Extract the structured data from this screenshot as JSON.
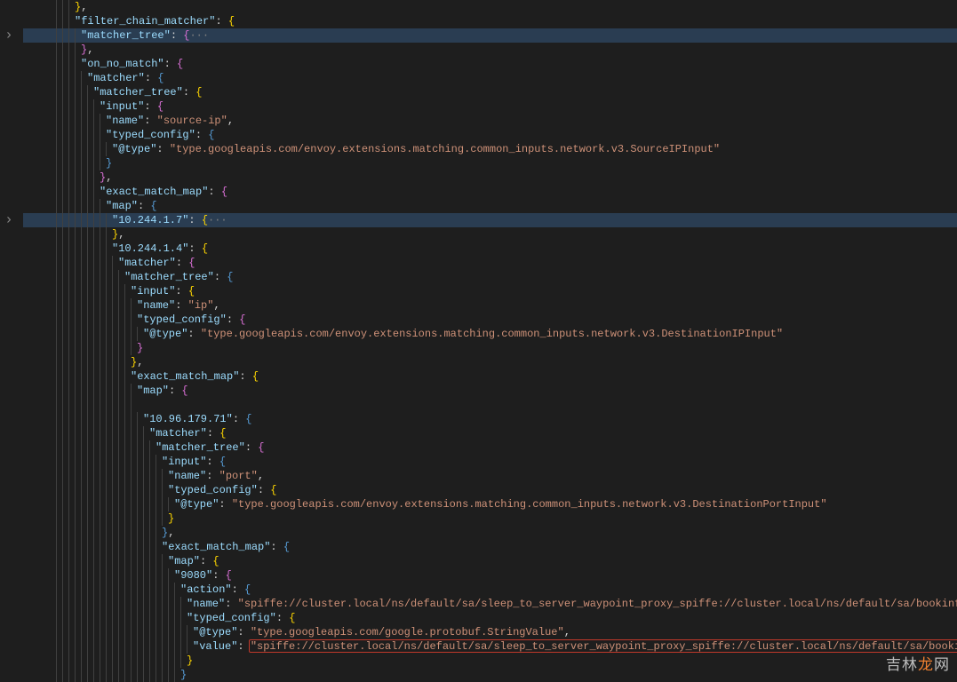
{
  "lines": [
    {
      "indent": 4,
      "parts": [
        {
          "c": "brace",
          "t": "}"
        },
        {
          "c": "punct",
          "t": ","
        }
      ],
      "hl": false
    },
    {
      "indent": 4,
      "parts": [
        {
          "c": "key",
          "t": "\"filter_chain_matcher\""
        },
        {
          "c": "punct",
          "t": ": "
        },
        {
          "c": "brace",
          "t": "{"
        }
      ],
      "hl": false
    },
    {
      "indent": 5,
      "parts": [
        {
          "c": "key",
          "t": "\"matcher_tree\""
        },
        {
          "c": "punct",
          "t": ": "
        },
        {
          "c": "brace-p",
          "t": "{"
        },
        {
          "c": "fold-dots",
          "t": "···"
        }
      ],
      "hl": true,
      "fold": true
    },
    {
      "indent": 5,
      "parts": [
        {
          "c": "brace-p",
          "t": "}"
        },
        {
          "c": "punct",
          "t": ","
        }
      ],
      "hl": false
    },
    {
      "indent": 5,
      "parts": [
        {
          "c": "key",
          "t": "\"on_no_match\""
        },
        {
          "c": "punct",
          "t": ": "
        },
        {
          "c": "brace-p",
          "t": "{"
        }
      ],
      "hl": false
    },
    {
      "indent": 6,
      "parts": [
        {
          "c": "key",
          "t": "\"matcher\""
        },
        {
          "c": "punct",
          "t": ": "
        },
        {
          "c": "brace-b",
          "t": "{"
        }
      ],
      "hl": false
    },
    {
      "indent": 7,
      "parts": [
        {
          "c": "key",
          "t": "\"matcher_tree\""
        },
        {
          "c": "punct",
          "t": ": "
        },
        {
          "c": "brace",
          "t": "{"
        }
      ],
      "hl": false
    },
    {
      "indent": 8,
      "parts": [
        {
          "c": "key",
          "t": "\"input\""
        },
        {
          "c": "punct",
          "t": ": "
        },
        {
          "c": "brace-p",
          "t": "{"
        }
      ],
      "hl": false
    },
    {
      "indent": 9,
      "parts": [
        {
          "c": "key",
          "t": "\"name\""
        },
        {
          "c": "punct",
          "t": ": "
        },
        {
          "c": "str",
          "t": "\"source-ip\""
        },
        {
          "c": "punct",
          "t": ","
        }
      ],
      "hl": false
    },
    {
      "indent": 9,
      "parts": [
        {
          "c": "key",
          "t": "\"typed_config\""
        },
        {
          "c": "punct",
          "t": ": "
        },
        {
          "c": "brace-b",
          "t": "{"
        }
      ],
      "hl": false
    },
    {
      "indent": 10,
      "parts": [
        {
          "c": "key",
          "t": "\"@type\""
        },
        {
          "c": "punct",
          "t": ": "
        },
        {
          "c": "str",
          "t": "\"type.googleapis.com/envoy.extensions.matching.common_inputs.network.v3.SourceIPInput\""
        }
      ],
      "hl": false
    },
    {
      "indent": 9,
      "parts": [
        {
          "c": "brace-b",
          "t": "}"
        }
      ],
      "hl": false
    },
    {
      "indent": 8,
      "parts": [
        {
          "c": "brace-p",
          "t": "}"
        },
        {
          "c": "punct",
          "t": ","
        }
      ],
      "hl": false
    },
    {
      "indent": 8,
      "parts": [
        {
          "c": "key",
          "t": "\"exact_match_map\""
        },
        {
          "c": "punct",
          "t": ": "
        },
        {
          "c": "brace-p",
          "t": "{"
        }
      ],
      "hl": false
    },
    {
      "indent": 9,
      "parts": [
        {
          "c": "key",
          "t": "\"map\""
        },
        {
          "c": "punct",
          "t": ": "
        },
        {
          "c": "brace-b",
          "t": "{"
        }
      ],
      "hl": false
    },
    {
      "indent": 10,
      "parts": [
        {
          "c": "key",
          "t": "\"10.244.1.7\""
        },
        {
          "c": "punct",
          "t": ": "
        },
        {
          "c": "brace",
          "t": "{"
        },
        {
          "c": "fold-dots",
          "t": "···"
        }
      ],
      "hl": true,
      "fold": true
    },
    {
      "indent": 10,
      "parts": [
        {
          "c": "brace",
          "t": "}"
        },
        {
          "c": "punct",
          "t": ","
        }
      ],
      "hl": false
    },
    {
      "indent": 10,
      "parts": [
        {
          "c": "key",
          "t": "\"10.244.1.4\""
        },
        {
          "c": "punct",
          "t": ": "
        },
        {
          "c": "brace",
          "t": "{"
        }
      ],
      "hl": false
    },
    {
      "indent": 11,
      "parts": [
        {
          "c": "key",
          "t": "\"matcher\""
        },
        {
          "c": "punct",
          "t": ": "
        },
        {
          "c": "brace-p",
          "t": "{"
        }
      ],
      "hl": false
    },
    {
      "indent": 12,
      "parts": [
        {
          "c": "key",
          "t": "\"matcher_tree\""
        },
        {
          "c": "punct",
          "t": ": "
        },
        {
          "c": "brace-b",
          "t": "{"
        }
      ],
      "hl": false
    },
    {
      "indent": 13,
      "parts": [
        {
          "c": "key",
          "t": "\"input\""
        },
        {
          "c": "punct",
          "t": ": "
        },
        {
          "c": "brace",
          "t": "{"
        }
      ],
      "hl": false
    },
    {
      "indent": 14,
      "parts": [
        {
          "c": "key",
          "t": "\"name\""
        },
        {
          "c": "punct",
          "t": ": "
        },
        {
          "c": "str",
          "t": "\"ip\""
        },
        {
          "c": "punct",
          "t": ","
        }
      ],
      "hl": false
    },
    {
      "indent": 14,
      "parts": [
        {
          "c": "key",
          "t": "\"typed_config\""
        },
        {
          "c": "punct",
          "t": ": "
        },
        {
          "c": "brace-p",
          "t": "{"
        }
      ],
      "hl": false
    },
    {
      "indent": 15,
      "parts": [
        {
          "c": "key",
          "t": "\"@type\""
        },
        {
          "c": "punct",
          "t": ": "
        },
        {
          "c": "str",
          "t": "\"type.googleapis.com/envoy.extensions.matching.common_inputs.network.v3.DestinationIPInput\""
        }
      ],
      "hl": false
    },
    {
      "indent": 14,
      "parts": [
        {
          "c": "brace-p",
          "t": "}"
        }
      ],
      "hl": false
    },
    {
      "indent": 13,
      "parts": [
        {
          "c": "brace",
          "t": "}"
        },
        {
          "c": "punct",
          "t": ","
        }
      ],
      "hl": false
    },
    {
      "indent": 13,
      "parts": [
        {
          "c": "key",
          "t": "\"exact_match_map\""
        },
        {
          "c": "punct",
          "t": ": "
        },
        {
          "c": "brace",
          "t": "{"
        }
      ],
      "hl": false
    },
    {
      "indent": 14,
      "parts": [
        {
          "c": "key",
          "t": "\"map\""
        },
        {
          "c": "punct",
          "t": ": "
        },
        {
          "c": "brace-p",
          "t": "{"
        }
      ],
      "hl": false
    },
    {
      "indent": 14,
      "parts": [],
      "hl": false
    },
    {
      "indent": 15,
      "parts": [
        {
          "c": "key",
          "t": "\"10.96.179.71\""
        },
        {
          "c": "punct",
          "t": ": "
        },
        {
          "c": "brace-b",
          "t": "{"
        }
      ],
      "hl": false
    },
    {
      "indent": 16,
      "parts": [
        {
          "c": "key",
          "t": "\"matcher\""
        },
        {
          "c": "punct",
          "t": ": "
        },
        {
          "c": "brace",
          "t": "{"
        }
      ],
      "hl": false
    },
    {
      "indent": 17,
      "parts": [
        {
          "c": "key",
          "t": "\"matcher_tree\""
        },
        {
          "c": "punct",
          "t": ": "
        },
        {
          "c": "brace-p",
          "t": "{"
        }
      ],
      "hl": false
    },
    {
      "indent": 18,
      "parts": [
        {
          "c": "key",
          "t": "\"input\""
        },
        {
          "c": "punct",
          "t": ": "
        },
        {
          "c": "brace-b",
          "t": "{"
        }
      ],
      "hl": false
    },
    {
      "indent": 19,
      "parts": [
        {
          "c": "key",
          "t": "\"name\""
        },
        {
          "c": "punct",
          "t": ": "
        },
        {
          "c": "str",
          "t": "\"port\""
        },
        {
          "c": "punct",
          "t": ","
        }
      ],
      "hl": false
    },
    {
      "indent": 19,
      "parts": [
        {
          "c": "key",
          "t": "\"typed_config\""
        },
        {
          "c": "punct",
          "t": ": "
        },
        {
          "c": "brace",
          "t": "{"
        }
      ],
      "hl": false
    },
    {
      "indent": 20,
      "parts": [
        {
          "c": "key",
          "t": "\"@type\""
        },
        {
          "c": "punct",
          "t": ": "
        },
        {
          "c": "str",
          "t": "\"type.googleapis.com/envoy.extensions.matching.common_inputs.network.v3.DestinationPortInput\""
        }
      ],
      "hl": false
    },
    {
      "indent": 19,
      "parts": [
        {
          "c": "brace",
          "t": "}"
        }
      ],
      "hl": false
    },
    {
      "indent": 18,
      "parts": [
        {
          "c": "brace-b",
          "t": "}"
        },
        {
          "c": "punct",
          "t": ","
        }
      ],
      "hl": false
    },
    {
      "indent": 18,
      "parts": [
        {
          "c": "key",
          "t": "\"exact_match_map\""
        },
        {
          "c": "punct",
          "t": ": "
        },
        {
          "c": "brace-b",
          "t": "{"
        }
      ],
      "hl": false
    },
    {
      "indent": 19,
      "parts": [
        {
          "c": "key",
          "t": "\"map\""
        },
        {
          "c": "punct",
          "t": ": "
        },
        {
          "c": "brace",
          "t": "{"
        }
      ],
      "hl": false
    },
    {
      "indent": 20,
      "parts": [
        {
          "c": "key",
          "t": "\"9080\""
        },
        {
          "c": "punct",
          "t": ": "
        },
        {
          "c": "brace-p",
          "t": "{"
        }
      ],
      "hl": false
    },
    {
      "indent": 21,
      "parts": [
        {
          "c": "key",
          "t": "\"action\""
        },
        {
          "c": "punct",
          "t": ": "
        },
        {
          "c": "brace-b",
          "t": "{"
        }
      ],
      "hl": false
    },
    {
      "indent": 22,
      "parts": [
        {
          "c": "key",
          "t": "\"name\""
        },
        {
          "c": "punct",
          "t": ": "
        },
        {
          "c": "str",
          "t": "\"spiffe://cluster.local/ns/default/sa/sleep_to_server_waypoint_proxy_spiffe://cluster.local/ns/default/sa/bookinfo-productpage\""
        },
        {
          "c": "punct",
          "t": ","
        }
      ],
      "hl": false
    },
    {
      "indent": 22,
      "parts": [
        {
          "c": "key",
          "t": "\"typed_config\""
        },
        {
          "c": "punct",
          "t": ": "
        },
        {
          "c": "brace",
          "t": "{"
        }
      ],
      "hl": false
    },
    {
      "indent": 23,
      "parts": [
        {
          "c": "key",
          "t": "\"@type\""
        },
        {
          "c": "punct",
          "t": ": "
        },
        {
          "c": "str",
          "t": "\"type.googleapis.com/google.protobuf.StringValue\""
        },
        {
          "c": "punct",
          "t": ","
        }
      ],
      "hl": false
    },
    {
      "indent": 23,
      "parts": [
        {
          "c": "key",
          "t": "\"value\""
        },
        {
          "c": "punct",
          "t": ": "
        },
        {
          "c": "str",
          "t": "\"spiffe://cluster.local/ns/default/sa/sleep_to_server_waypoint_proxy_spiffe://cluster.local/ns/default/sa/bookinfo-productpage\""
        }
      ],
      "hl": false,
      "boxStart": 23
    },
    {
      "indent": 22,
      "parts": [
        {
          "c": "brace",
          "t": "}"
        }
      ],
      "hl": false
    },
    {
      "indent": 21,
      "parts": [
        {
          "c": "brace-b",
          "t": "}"
        }
      ],
      "hl": false
    }
  ],
  "watermark": {
    "pre": "吉林",
    "accent": "龙",
    "post": "网"
  },
  "foldChevrons": [
    2,
    15
  ],
  "highlightBox": {
    "lineIndex": 45,
    "charStart": 9
  },
  "indentWidth": 7,
  "baseIndent": 1
}
